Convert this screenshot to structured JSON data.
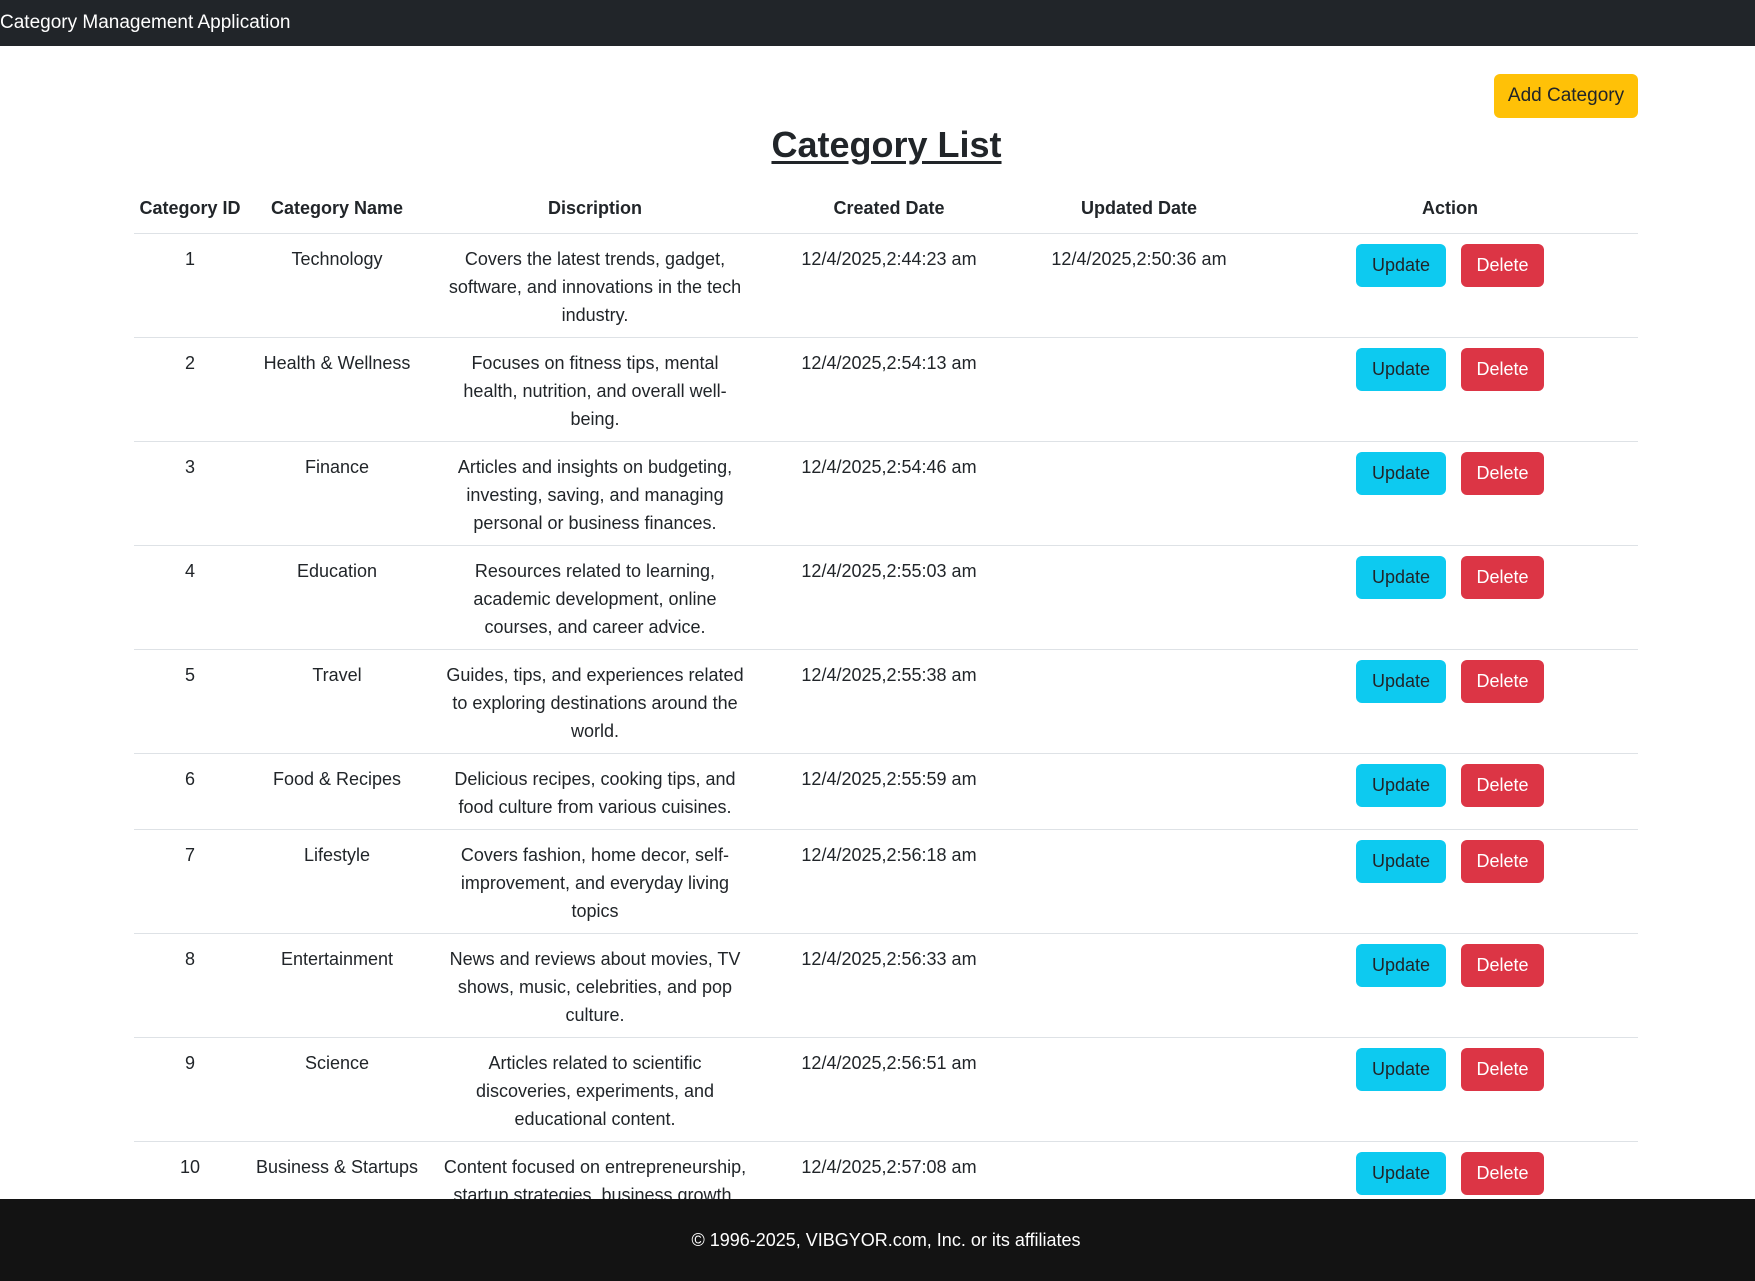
{
  "navbar": {
    "brand": "Category Management Application"
  },
  "toolbar": {
    "add_label": "Add Category"
  },
  "page": {
    "title": "Category List"
  },
  "table": {
    "headers": [
      "Category ID",
      "Category Name",
      "Discription",
      "Created Date",
      "Updated Date",
      "Action"
    ],
    "update_label": "Update",
    "delete_label": "Delete",
    "rows": [
      {
        "id": "1",
        "name": "Technology",
        "description": "Covers the latest trends, gadget, software, and innovations in the tech industry.",
        "created": "12/4/2025,2:44:23 am",
        "updated": "12/4/2025,2:50:36 am"
      },
      {
        "id": "2",
        "name": "Health & Wellness",
        "description": "Focuses on fitness tips, mental health, nutrition, and overall well-being.",
        "created": "12/4/2025,2:54:13 am",
        "updated": ""
      },
      {
        "id": "3",
        "name": "Finance",
        "description": "Articles and insights on budgeting, investing, saving, and managing personal or business finances.",
        "created": "12/4/2025,2:54:46 am",
        "updated": ""
      },
      {
        "id": "4",
        "name": "Education",
        "description": "Resources related to learning, academic development, online courses, and career advice.",
        "created": "12/4/2025,2:55:03 am",
        "updated": ""
      },
      {
        "id": "5",
        "name": "Travel",
        "description": "Guides, tips, and experiences related to exploring destinations around the world.",
        "created": "12/4/2025,2:55:38 am",
        "updated": ""
      },
      {
        "id": "6",
        "name": "Food & Recipes",
        "description": "Delicious recipes, cooking tips, and food culture from various cuisines.",
        "created": "12/4/2025,2:55:59 am",
        "updated": ""
      },
      {
        "id": "7",
        "name": "Lifestyle",
        "description": "Covers fashion, home decor, self-improvement, and everyday living topics",
        "created": "12/4/2025,2:56:18 am",
        "updated": ""
      },
      {
        "id": "8",
        "name": "Entertainment",
        "description": "News and reviews about movies, TV shows, music, celebrities, and pop culture.",
        "created": "12/4/2025,2:56:33 am",
        "updated": ""
      },
      {
        "id": "9",
        "name": "Science",
        "description": "Articles related to scientific discoveries, experiments, and educational content.",
        "created": "12/4/2025,2:56:51 am",
        "updated": ""
      },
      {
        "id": "10",
        "name": "Business & Startups",
        "description": "Content focused on entrepreneurship, startup strategies, business growth, and industry news.",
        "created": "12/4/2025,2:57:08 am",
        "updated": ""
      }
    ]
  },
  "footer": {
    "text": "© 1996-2025, VIBGYOR.com, Inc. or its affiliates"
  },
  "colors": {
    "navbar": "#212529",
    "add_button": "#ffc107",
    "update_button": "#0dcaf0",
    "delete_button": "#dc3545",
    "footer": "#131313"
  }
}
